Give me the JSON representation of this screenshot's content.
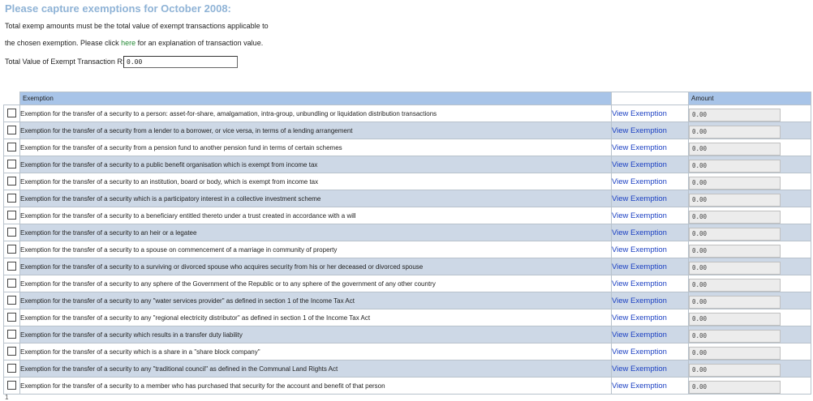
{
  "page": {
    "title": "Please capture exemptions for October 2008:",
    "intro_line1": "Total exemp amounts must be the total value of exempt transactions applicable to",
    "intro_line2_prefix": "the chosen exemption. Please click ",
    "intro_link": "here",
    "intro_line2_suffix": " for an explanation of transaction value.",
    "total_label": "Total Value of Exempt Transaction R:",
    "total_value": "0.00",
    "footer_number": "1"
  },
  "table": {
    "headers": {
      "exemption": "Exemption",
      "link": "",
      "amount": "Amount"
    },
    "link_label": "View Exemption",
    "rows": [
      {
        "exemption": "Exemption for the transfer of a security to a person: asset-for-share, amalgamation, intra-group, unbundling or liquidation distribution transactions",
        "amount": "0.00"
      },
      {
        "exemption": "Exemption for the transfer of a security from a lender to a borrower, or vice versa, in terms of a lending arrangement",
        "amount": "0.00"
      },
      {
        "exemption": "Exemption for the transfer of a security from a pension fund to another pension fund in terms of certain schemes",
        "amount": "0.00"
      },
      {
        "exemption": "Exemption for the transfer of a security to a public benefit organisation which is exempt from income tax",
        "amount": "0.00"
      },
      {
        "exemption": "Exemption for the transfer of a security to an institution, board or body, which is exempt from income tax",
        "amount": "0.00"
      },
      {
        "exemption": "Exemption for the transfer of a security which is a participatory interest in a collective investment scheme",
        "amount": "0.00"
      },
      {
        "exemption": "Exemption for the transfer of a security to a beneficiary entitled thereto under a trust created in accordance with a will",
        "amount": "0.00"
      },
      {
        "exemption": "Exemption for the transfer of a security to an heir or a legatee",
        "amount": "0.00"
      },
      {
        "exemption": "Exemption for the transfer of a security to a spouse on commencement of a marriage in community of property",
        "amount": "0.00"
      },
      {
        "exemption": "Exemption for the transfer of a security to a surviving or divorced spouse who acquires security from his or her deceased or divorced spouse",
        "amount": "0.00"
      },
      {
        "exemption": "Exemption for the transfer of a security to any sphere of the Government of the Republic or to any sphere of the government of any other country",
        "amount": "0.00"
      },
      {
        "exemption": "Exemption for the transfer of a security to any \"water services provider\" as defined in section 1 of the Income Tax Act",
        "amount": "0.00"
      },
      {
        "exemption": "Exemption for the transfer of a security to any \"regional electricity distributor\" as defined in section 1 of the Income Tax Act",
        "amount": "0.00"
      },
      {
        "exemption": "Exemption for the transfer of a security which results in a transfer duty liability",
        "amount": "0.00"
      },
      {
        "exemption": "Exemption for the transfer of a security which is a share in a \"share block company\"",
        "amount": "0.00"
      },
      {
        "exemption": "Exemption for the transfer of a security to any \"traditional council\" as defined in the Communal Land Rights Act",
        "amount": "0.00"
      },
      {
        "exemption": "Exemption for the transfer of a security to a member who has purchased that security for the account and benefit of that person",
        "amount": "0.00"
      }
    ]
  },
  "colors": {
    "title": "#8fb3d6",
    "header_bg": "#a8c4e8",
    "row_shade": "#cdd8e6",
    "link": "#1a3fc2",
    "help_link": "#228833"
  }
}
